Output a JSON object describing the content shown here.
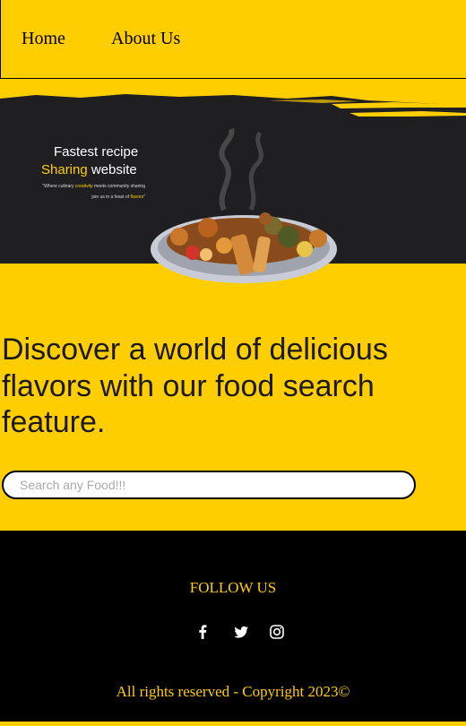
{
  "nav": {
    "home": "Home",
    "about": "About Us"
  },
  "hero": {
    "title_line1": "Fastest recipe",
    "title_line2_accent": "Sharing",
    "title_line2_rest": " website",
    "quote_line1_pre": "\"Where culinary ",
    "quote_line1_accent": "creativity",
    "quote_line1_post": " meets community sharing",
    "quote_line2_pre": "join us in a feast of ",
    "quote_line2_accent": "flavors",
    "quote_line2_post": "\""
  },
  "main": {
    "headline": "Discover a world of delicious flavors with our food search feature.",
    "search_placeholder": "Search any Food!!!"
  },
  "footer": {
    "follow": "FOLLOW US",
    "social": [
      "facebook-icon",
      "twitter-icon",
      "instagram-icon"
    ],
    "copyright": "All rights reserved - Copyright 2023©"
  },
  "colors": {
    "accent": "#FFCE00",
    "dark": "#000000",
    "hero_bg": "#1f1f21"
  }
}
